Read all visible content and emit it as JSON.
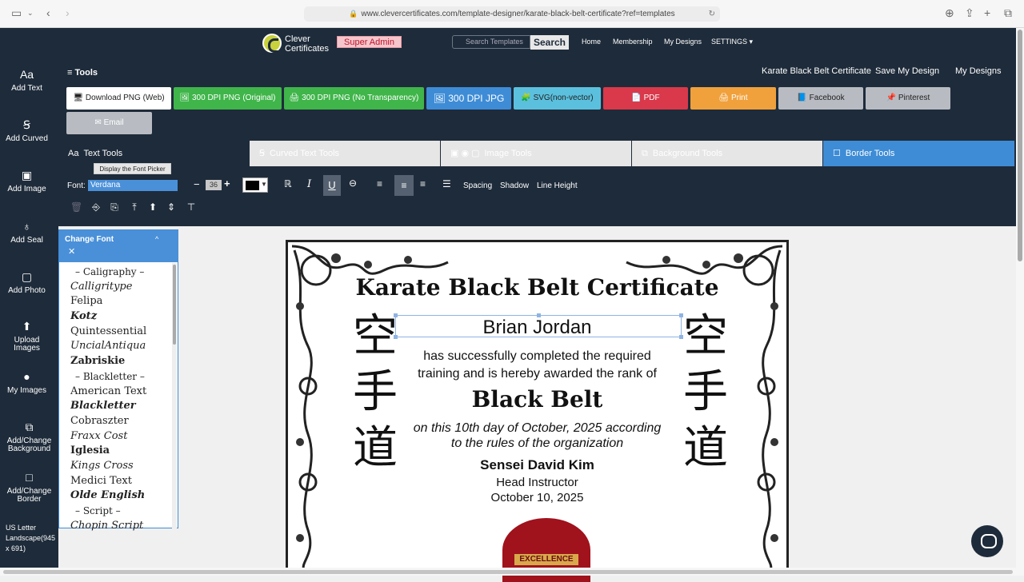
{
  "browser": {
    "url": "www.clevercertificates.com/template-designer/karate-black-belt-certificate?ref=templates"
  },
  "topnav": {
    "logo_line1": "Clever",
    "logo_line2": "Certificates",
    "super_admin": "Super Admin",
    "search_placeholder": "Search Templates",
    "search_button": "Search",
    "links": [
      "Home",
      "Membership",
      "My Designs",
      "SETTINGS ▾"
    ]
  },
  "leftbar": {
    "items": [
      {
        "icon": "Aa",
        "label": "Add Text"
      },
      {
        "icon": "Ꞩ",
        "label": "Add Curved"
      },
      {
        "icon": "▣",
        "label": "Add Image"
      },
      {
        "icon": "♁",
        "label": "Add Seal"
      },
      {
        "icon": "▢",
        "label": "Add Photo"
      },
      {
        "icon": "⬆",
        "label": "Upload Images"
      },
      {
        "icon": "●",
        "label": "My Images"
      },
      {
        "icon": "⧉",
        "label": "Add/Change Background"
      },
      {
        "icon": "□",
        "label": "Add/Change Border"
      }
    ],
    "page_size": "US Letter Landscape(945 x 691)"
  },
  "tools": {
    "title": "≡ Tools",
    "cert_title": "Karate Black Belt Certificate",
    "save_design": "Save My Design",
    "my_designs": "My Designs",
    "downloads": [
      {
        "label": "🖥 Download PNG (Web)",
        "color": "#ffffff",
        "text": "#222222"
      },
      {
        "label": "🖼 300 DPI PNG (Original)",
        "color": "#3fb54a",
        "text": "#ffffff"
      },
      {
        "label": "🖨 300 DPI PNG (No Transparency)",
        "color": "#3fb54a",
        "text": "#ffffff"
      },
      {
        "label": "🖼 300 DPI JPG",
        "color": "#3e8cd6",
        "text": "#ffffff"
      },
      {
        "label": "🧩 SVG(non-vector)",
        "color": "#5bc0de",
        "text": "#222222"
      },
      {
        "label": "📄 PDF",
        "color": "#d9394a",
        "text": "#ffffff"
      },
      {
        "label": "🖨 Print",
        "color": "#f0a13c",
        "text": "#ffffff"
      },
      {
        "label": "📘 Facebook",
        "color": "#b8bcc2",
        "text": "#222222"
      },
      {
        "label": "📌 Pinterest",
        "color": "#b8bcc2",
        "text": "#222222"
      },
      {
        "label": "✉ Email",
        "color": "#b8bcc2",
        "text": "#ffffff"
      }
    ],
    "tabs": [
      "Text Tools",
      "Curved Text Tools",
      "Image Tools",
      "Background Tools",
      "Border Tools"
    ],
    "font_label": "Font:",
    "font_value": "Verdana",
    "tooltip": "Display the Font Picker",
    "font_size": "36",
    "spacing": "Spacing",
    "shadow": "Shadow",
    "line_height": "Line Height"
  },
  "font_panel": {
    "title": "Change Font",
    "items": [
      {
        "name": "– Caligraphy –",
        "cat": true
      },
      {
        "name": "Calligritype",
        "cat": false
      },
      {
        "name": "Felipa",
        "cat": false
      },
      {
        "name": "Kotz",
        "cat": false
      },
      {
        "name": "Quintessential",
        "cat": false
      },
      {
        "name": "UncialAntiqua",
        "cat": false
      },
      {
        "name": "Zabriskie",
        "cat": false
      },
      {
        "name": "– Blackletter –",
        "cat": true
      },
      {
        "name": "American Text",
        "cat": false
      },
      {
        "name": "Blackletter",
        "cat": false
      },
      {
        "name": "Cobraszter",
        "cat": false
      },
      {
        "name": "Fraxx Cost",
        "cat": false
      },
      {
        "name": "Iglesia",
        "cat": false
      },
      {
        "name": "Kings Cross",
        "cat": false
      },
      {
        "name": "Medici Text",
        "cat": false
      },
      {
        "name": "Olde English",
        "cat": false
      },
      {
        "name": "– Script –",
        "cat": true
      },
      {
        "name": "Chopin Script",
        "cat": false
      }
    ]
  },
  "certificate": {
    "title": "Karate Black Belt Certificate",
    "name": "Brian Jordan",
    "line1": "has successfully completed the required",
    "line2": "training and is hereby awarded the rank of",
    "rank": "Black Belt",
    "date_line1": "on this 10th day of October, 2025 according",
    "date_line2": "to the rules of the organization",
    "sensei": "Sensei David Kim",
    "role": "Head Instructor",
    "date": "October 10, 2025",
    "kanji": [
      "空",
      "手",
      "道"
    ],
    "seal_text": "EXCELLENCE"
  }
}
